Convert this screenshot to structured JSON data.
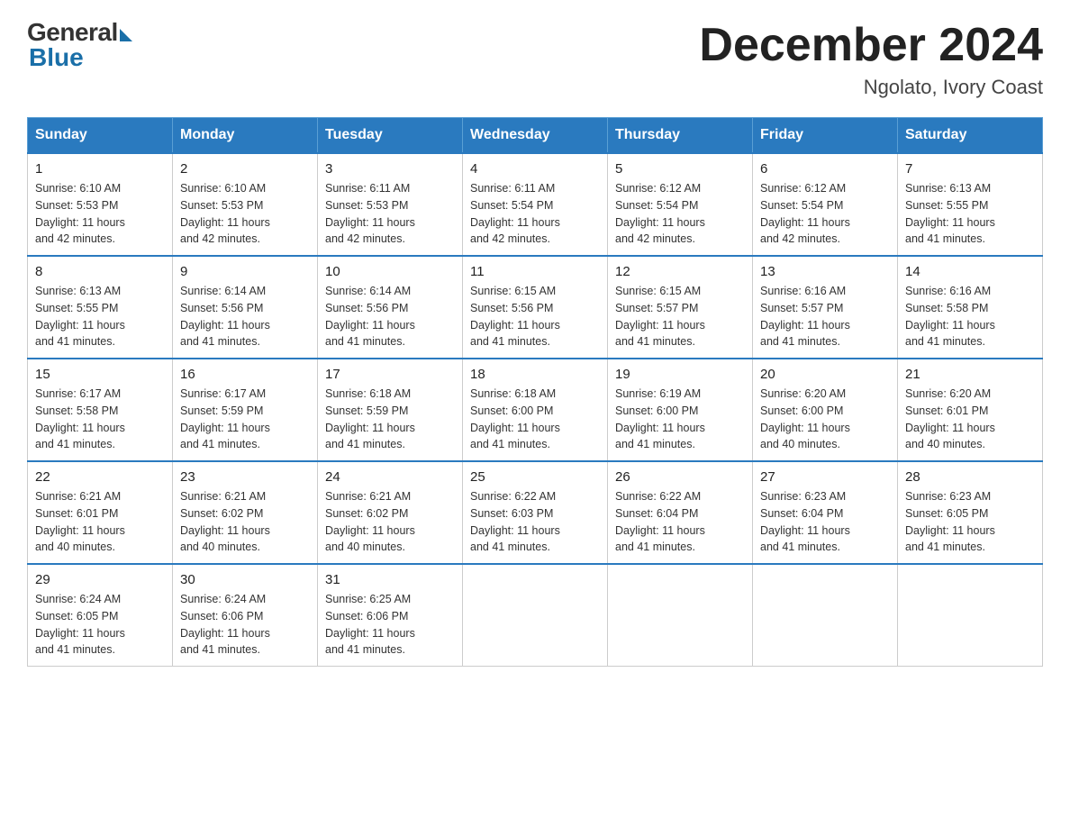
{
  "logo": {
    "general": "General",
    "blue": "Blue"
  },
  "title": "December 2024",
  "location": "Ngolato, Ivory Coast",
  "days_of_week": [
    "Sunday",
    "Monday",
    "Tuesday",
    "Wednesday",
    "Thursday",
    "Friday",
    "Saturday"
  ],
  "weeks": [
    [
      {
        "day": "1",
        "sunrise": "6:10 AM",
        "sunset": "5:53 PM",
        "daylight": "11 hours and 42 minutes."
      },
      {
        "day": "2",
        "sunrise": "6:10 AM",
        "sunset": "5:53 PM",
        "daylight": "11 hours and 42 minutes."
      },
      {
        "day": "3",
        "sunrise": "6:11 AM",
        "sunset": "5:53 PM",
        "daylight": "11 hours and 42 minutes."
      },
      {
        "day": "4",
        "sunrise": "6:11 AM",
        "sunset": "5:54 PM",
        "daylight": "11 hours and 42 minutes."
      },
      {
        "day": "5",
        "sunrise": "6:12 AM",
        "sunset": "5:54 PM",
        "daylight": "11 hours and 42 minutes."
      },
      {
        "day": "6",
        "sunrise": "6:12 AM",
        "sunset": "5:54 PM",
        "daylight": "11 hours and 42 minutes."
      },
      {
        "day": "7",
        "sunrise": "6:13 AM",
        "sunset": "5:55 PM",
        "daylight": "11 hours and 41 minutes."
      }
    ],
    [
      {
        "day": "8",
        "sunrise": "6:13 AM",
        "sunset": "5:55 PM",
        "daylight": "11 hours and 41 minutes."
      },
      {
        "day": "9",
        "sunrise": "6:14 AM",
        "sunset": "5:56 PM",
        "daylight": "11 hours and 41 minutes."
      },
      {
        "day": "10",
        "sunrise": "6:14 AM",
        "sunset": "5:56 PM",
        "daylight": "11 hours and 41 minutes."
      },
      {
        "day": "11",
        "sunrise": "6:15 AM",
        "sunset": "5:56 PM",
        "daylight": "11 hours and 41 minutes."
      },
      {
        "day": "12",
        "sunrise": "6:15 AM",
        "sunset": "5:57 PM",
        "daylight": "11 hours and 41 minutes."
      },
      {
        "day": "13",
        "sunrise": "6:16 AM",
        "sunset": "5:57 PM",
        "daylight": "11 hours and 41 minutes."
      },
      {
        "day": "14",
        "sunrise": "6:16 AM",
        "sunset": "5:58 PM",
        "daylight": "11 hours and 41 minutes."
      }
    ],
    [
      {
        "day": "15",
        "sunrise": "6:17 AM",
        "sunset": "5:58 PM",
        "daylight": "11 hours and 41 minutes."
      },
      {
        "day": "16",
        "sunrise": "6:17 AM",
        "sunset": "5:59 PM",
        "daylight": "11 hours and 41 minutes."
      },
      {
        "day": "17",
        "sunrise": "6:18 AM",
        "sunset": "5:59 PM",
        "daylight": "11 hours and 41 minutes."
      },
      {
        "day": "18",
        "sunrise": "6:18 AM",
        "sunset": "6:00 PM",
        "daylight": "11 hours and 41 minutes."
      },
      {
        "day": "19",
        "sunrise": "6:19 AM",
        "sunset": "6:00 PM",
        "daylight": "11 hours and 41 minutes."
      },
      {
        "day": "20",
        "sunrise": "6:20 AM",
        "sunset": "6:00 PM",
        "daylight": "11 hours and 40 minutes."
      },
      {
        "day": "21",
        "sunrise": "6:20 AM",
        "sunset": "6:01 PM",
        "daylight": "11 hours and 40 minutes."
      }
    ],
    [
      {
        "day": "22",
        "sunrise": "6:21 AM",
        "sunset": "6:01 PM",
        "daylight": "11 hours and 40 minutes."
      },
      {
        "day": "23",
        "sunrise": "6:21 AM",
        "sunset": "6:02 PM",
        "daylight": "11 hours and 40 minutes."
      },
      {
        "day": "24",
        "sunrise": "6:21 AM",
        "sunset": "6:02 PM",
        "daylight": "11 hours and 40 minutes."
      },
      {
        "day": "25",
        "sunrise": "6:22 AM",
        "sunset": "6:03 PM",
        "daylight": "11 hours and 41 minutes."
      },
      {
        "day": "26",
        "sunrise": "6:22 AM",
        "sunset": "6:04 PM",
        "daylight": "11 hours and 41 minutes."
      },
      {
        "day": "27",
        "sunrise": "6:23 AM",
        "sunset": "6:04 PM",
        "daylight": "11 hours and 41 minutes."
      },
      {
        "day": "28",
        "sunrise": "6:23 AM",
        "sunset": "6:05 PM",
        "daylight": "11 hours and 41 minutes."
      }
    ],
    [
      {
        "day": "29",
        "sunrise": "6:24 AM",
        "sunset": "6:05 PM",
        "daylight": "11 hours and 41 minutes."
      },
      {
        "day": "30",
        "sunrise": "6:24 AM",
        "sunset": "6:06 PM",
        "daylight": "11 hours and 41 minutes."
      },
      {
        "day": "31",
        "sunrise": "6:25 AM",
        "sunset": "6:06 PM",
        "daylight": "11 hours and 41 minutes."
      },
      null,
      null,
      null,
      null
    ]
  ],
  "labels": {
    "sunrise": "Sunrise:",
    "sunset": "Sunset:",
    "daylight": "Daylight:"
  }
}
